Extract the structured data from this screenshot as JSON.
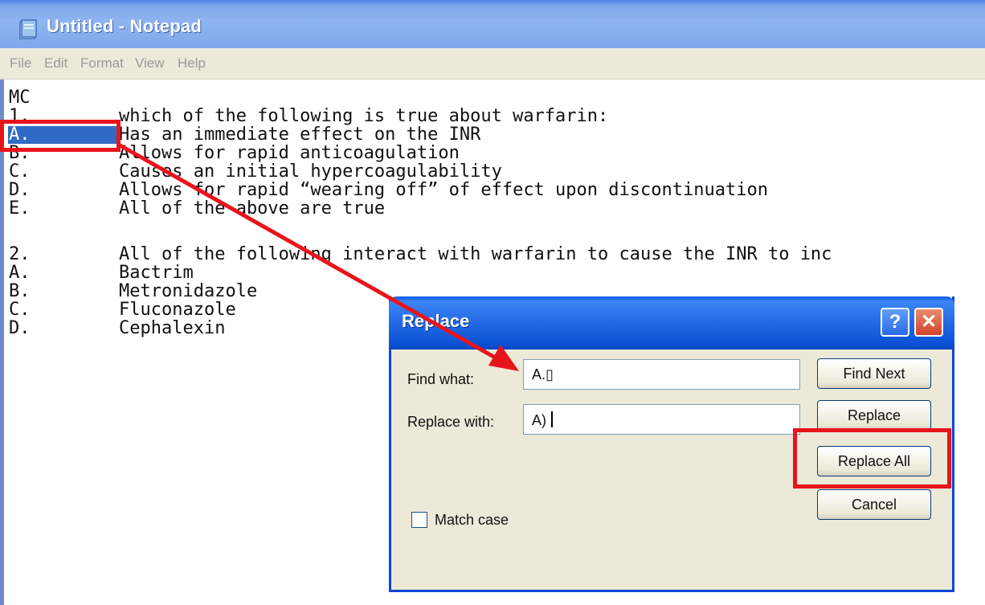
{
  "notepad": {
    "title": "Untitled - Notepad",
    "menu": [
      "File",
      "Edit",
      "Format",
      "View",
      "Help"
    ],
    "lines": [
      {
        "num": "MC",
        "text": ""
      },
      {
        "num": "1.",
        "text": "which of the following is true about warfarin:"
      },
      {
        "num": "A.",
        "text": "Has an immediate effect on the INR"
      },
      {
        "num": "B.",
        "text": "Allows for rapid anticoagulation"
      },
      {
        "num": "C.",
        "text": "Causes an initial hypercoagulability"
      },
      {
        "num": "D.",
        "text": "Allows for rapid “wearing off” of effect upon discontinuation"
      },
      {
        "num": "E.",
        "text": "All of the above are true"
      },
      {
        "num": "2.",
        "text": "All of the following interact with warfarin to cause the INR to inc"
      },
      {
        "num": "A.",
        "text": "Bactrim"
      },
      {
        "num": "B.",
        "text": "Metronidazole"
      },
      {
        "num": "C.",
        "text": "Fluconazole"
      },
      {
        "num": "D.",
        "text": "Cephalexin"
      }
    ]
  },
  "dialog": {
    "title": "Replace",
    "help_glyph": "?",
    "close_glyph": "✕",
    "find_label": "Find what:",
    "find_value": "A.▯",
    "replace_label": "Replace with:",
    "replace_value": "A)",
    "buttons": {
      "find_next": "Find Next",
      "replace": "Replace",
      "replace_all": "Replace All",
      "cancel": "Cancel"
    },
    "match_case_label": "Match case"
  },
  "annotation_color": "#e8141c"
}
